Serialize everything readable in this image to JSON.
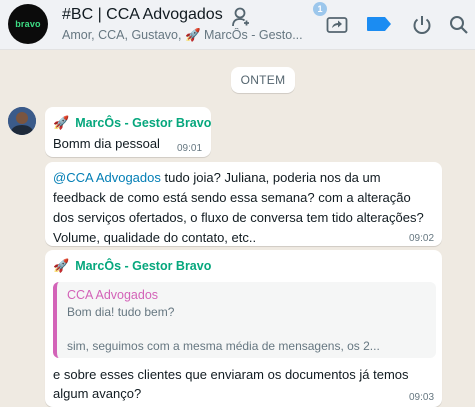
{
  "header": {
    "avatar_text": "bravo",
    "title": "#BC | CCA Advogados",
    "subtitle": "Amor, CCA, Gustavo, 🚀 MarcÔs - Gesto...",
    "badge_count": "1"
  },
  "date_separator": "ONTEM",
  "messages": [
    {
      "sender": "MarcÔs - Gestor Bravo",
      "text": "Bomm dia pessoal",
      "time": "09:01"
    },
    {
      "mention": "@CCA Advogados",
      "lines": [
        " tudo joia? Juliana, poderia nos da um",
        "feedback de como está sendo essa semana?  com a alteração",
        "dos serviços ofertados, o fluxo de conversa tem tido alterações?",
        "Volume, qualidade do contato, etc.."
      ],
      "time": "09:02"
    },
    {
      "sender": "MarcÔs - Gestor Bravo",
      "quote": {
        "author": "CCA Advogados",
        "line1": "Bom dia! tudo bem?",
        "line2": "sim, seguimos com a mesma média de mensagens, os 2..."
      },
      "lines": [
        "e sobre esses clientes que enviaram os documentos já temos",
        "algum avanço?"
      ],
      "time": "09:03"
    }
  ],
  "colors": {
    "sender": "#06a77d",
    "mention": "#027eb5",
    "quote_author": "#d363b8",
    "label_icon": "#1b8cf2"
  }
}
